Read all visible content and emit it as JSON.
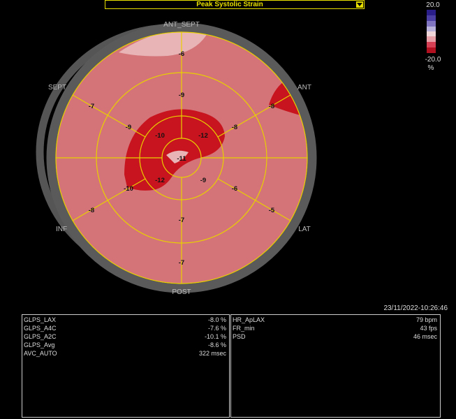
{
  "header": {
    "parameter_select": "Peak Systolic Strain"
  },
  "colorbar": {
    "max": "20.0",
    "min": "-20.0",
    "unit": "%"
  },
  "bullseye": {
    "directions": {
      "top": "ANT_SEPT",
      "upper_right": "ANT",
      "upper_left": "SEPT",
      "lower_left": "INF",
      "lower_right": "LAT",
      "bottom": "POST"
    },
    "outer_ring": [
      "-6",
      "-8",
      "-5",
      "-7",
      "-8",
      "-7"
    ],
    "middle_ring": [
      "-9",
      "-8",
      "-6",
      "-7",
      "-10",
      "-9"
    ],
    "inner_ring": [
      "-12",
      "-9",
      "-12",
      "-10"
    ],
    "apex": "-11"
  },
  "timestamp": "23/11/2022-10:26:46",
  "left_panel": [
    {
      "label": "GLPS_LAX",
      "value": "-8.0 %"
    },
    {
      "label": "GLPS_A4C",
      "value": "-7.6 %"
    },
    {
      "label": "GLPS_A2C",
      "value": "-10.1 %"
    },
    {
      "label": "GLPS_Avg",
      "value": "-8.6 %"
    },
    {
      "label": "AVC_AUTO",
      "value": "322 msec"
    }
  ],
  "right_panel": [
    {
      "label": "HR_ApLAX",
      "value": "79 bpm"
    },
    {
      "label": "FR_min",
      "value": "43 fps"
    },
    {
      "label": "PSD",
      "value": "46 msec"
    }
  ]
}
